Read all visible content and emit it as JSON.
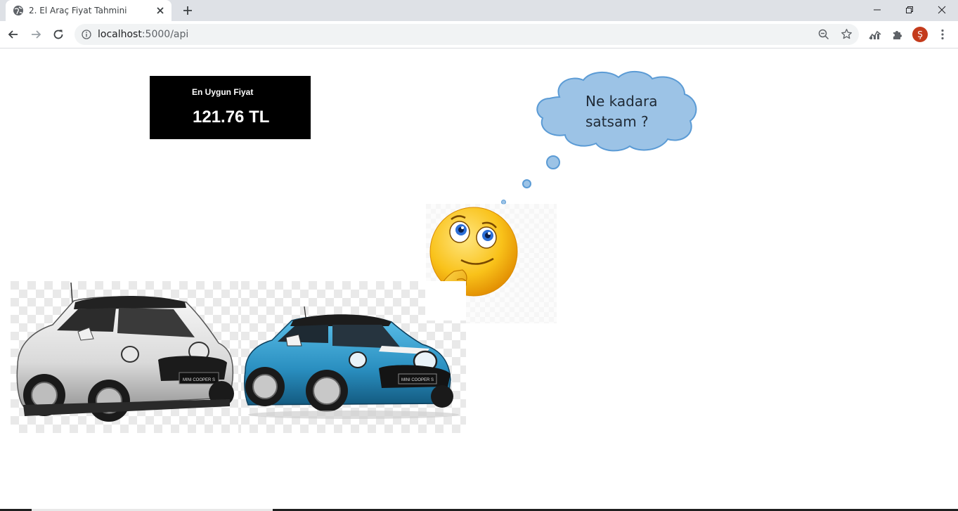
{
  "browser": {
    "tab_title": "2. El Araç Fiyat Tahmini",
    "url_host": "localhost",
    "url_path": ":5000/api",
    "avatar_letter": "Ş"
  },
  "price": {
    "label": "En Uygun Fiyat",
    "value": "121.76 TL"
  },
  "thought": {
    "text": "Ne kadara\nsatsam ?"
  },
  "car_plates": {
    "white": "MINI COOPER S",
    "blue": "MINI COOPER S"
  },
  "icons": {
    "favicon": "globe-icon",
    "tab_close": "close-icon",
    "new_tab": "plus-icon",
    "back": "arrow-left-icon",
    "forward": "arrow-right-icon",
    "reload": "reload-icon",
    "info": "info-icon",
    "zoom": "zoom-icon",
    "bookmark": "star-icon",
    "extension1": "analytics-icon",
    "extension2": "puzzle-icon",
    "menu": "kebab-menu-icon"
  },
  "colors": {
    "price_box_bg": "#000000",
    "cloud_fill": "#9cc3e6",
    "cloud_stroke": "#5b9bd5",
    "avatar_bg": "#c43b1c",
    "car_white": "#e6e6e6",
    "car_blue": "#2a8fc0"
  }
}
